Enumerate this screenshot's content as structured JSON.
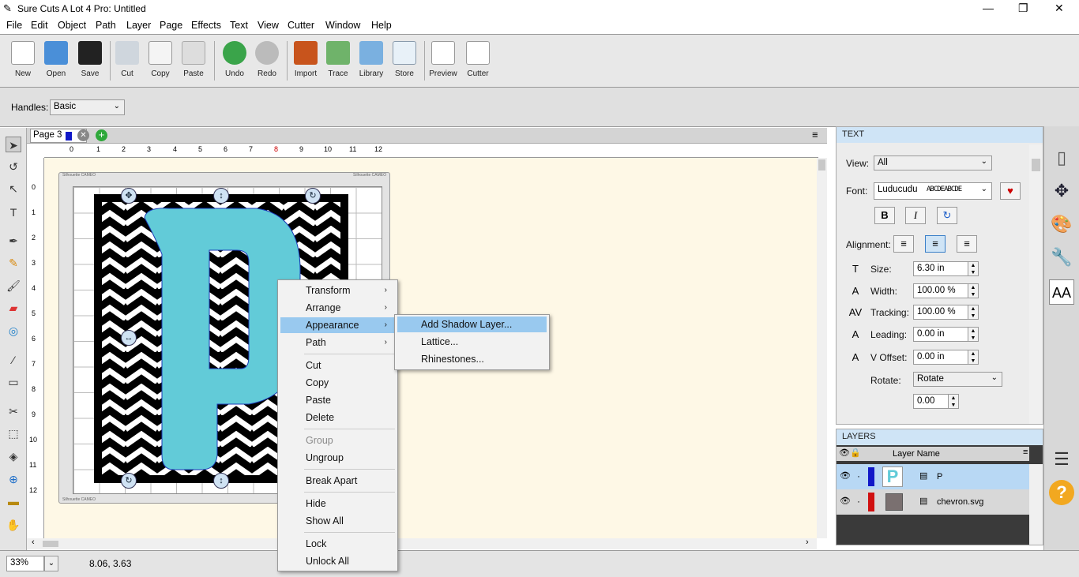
{
  "app": {
    "title": "Sure Cuts A Lot 4 Pro: Untitled",
    "window_controls": [
      "—",
      "❐",
      "✕"
    ]
  },
  "menubar": [
    "File",
    "Edit",
    "Object",
    "Path",
    "Layer",
    "Page",
    "Effects",
    "Text",
    "View",
    "Cutter",
    "Window",
    "Help"
  ],
  "toolbar": [
    {
      "label": "New",
      "icon": "new-document-icon"
    },
    {
      "label": "Open",
      "icon": "open-folder-icon"
    },
    {
      "label": "Save",
      "icon": "floppy-disk-icon"
    },
    {
      "label": "Cut",
      "icon": "scissors-icon"
    },
    {
      "label": "Copy",
      "icon": "copy-icon"
    },
    {
      "label": "Paste",
      "icon": "paste-icon"
    },
    {
      "label": "Undo",
      "icon": "undo-arrow-icon"
    },
    {
      "label": "Redo",
      "icon": "redo-arrow-icon"
    },
    {
      "label": "Import",
      "icon": "svg-import-icon"
    },
    {
      "label": "Trace",
      "icon": "trace-image-icon"
    },
    {
      "label": "Library",
      "icon": "star-library-icon"
    },
    {
      "label": "Store",
      "icon": "shopping-cart-icon"
    },
    {
      "label": "Preview",
      "icon": "magnifier-icon"
    },
    {
      "label": "Cutter",
      "icon": "pen-cutter-icon"
    }
  ],
  "options": {
    "handles_label": "Handles:",
    "handles_value": "Basic"
  },
  "page_tab": {
    "label": "Page 3",
    "color": "#1018c8"
  },
  "ruler": {
    "h_ticks": [
      "0",
      "1",
      "2",
      "3",
      "4",
      "5",
      "6",
      "7",
      "8",
      "9",
      "10",
      "11",
      "12"
    ],
    "v_ticks": [
      "0",
      "1",
      "2",
      "3",
      "4",
      "5",
      "6",
      "7",
      "8",
      "9",
      "10",
      "11",
      "12"
    ]
  },
  "mat": {
    "brand_left": "Silhouette CAMEO",
    "brand_right": "Silhouette CAMEO",
    "brand_bottom": "Silhouette CAMEO"
  },
  "design": {
    "letter": "P",
    "letter_color": "#62cbd8"
  },
  "context_menu": {
    "items": [
      {
        "label": "Transform",
        "submenu": true
      },
      {
        "label": "Arrange",
        "submenu": true
      },
      {
        "label": "Appearance",
        "submenu": true,
        "selected": true
      },
      {
        "label": "Path",
        "submenu": true
      },
      {
        "label": "Cut"
      },
      {
        "label": "Copy"
      },
      {
        "label": "Paste"
      },
      {
        "label": "Delete"
      },
      {
        "label": "Group",
        "disabled": true
      },
      {
        "label": "Ungroup"
      },
      {
        "label": "Break Apart"
      },
      {
        "label": "Hide"
      },
      {
        "label": "Show All"
      },
      {
        "label": "Lock"
      },
      {
        "label": "Unlock All"
      }
    ],
    "submenu": [
      "Add Shadow Layer...",
      "Lattice...",
      "Rhinestones..."
    ]
  },
  "text_panel": {
    "header": "TEXT",
    "view_label": "View:",
    "view_value": "All",
    "font_label": "Font:",
    "font_value": "Luducudu",
    "font_sample": "ABCDEABCDE",
    "style_buttons": [
      "B",
      "I",
      "↻"
    ],
    "alignment_label": "Alignment:",
    "size_label": "Size:",
    "size_value": "6.30 in",
    "width_label": "Width:",
    "width_value": "100.00 %",
    "tracking_label": "Tracking:",
    "tracking_value": "100.00 %",
    "leading_label": "Leading:",
    "leading_value": "0.00 in",
    "voffset_label": "V Offset:",
    "voffset_value": "0.00 in",
    "rotate_label": "Rotate:",
    "rotate_value": "Rotate",
    "rotate_angle": "0.00"
  },
  "layers_panel": {
    "header": "LAYERS",
    "column": "Layer Name",
    "rows": [
      {
        "name": "P",
        "color": "#1018c8",
        "selected": true
      },
      {
        "name": "chevron.svg",
        "color": "#d01010",
        "selected": false
      }
    ]
  },
  "status": {
    "zoom": "33%",
    "coords": "8.06, 3.63"
  }
}
